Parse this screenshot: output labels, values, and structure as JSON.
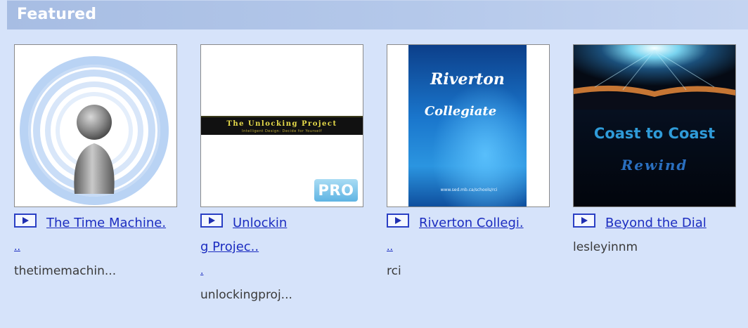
{
  "section": {
    "title": "Featured"
  },
  "items": [
    {
      "title_line1": "The Time Machine.",
      "title_line2": "..",
      "title_line3": "",
      "author": "thetimemachin...",
      "thumbnail": "podcast-person-icon"
    },
    {
      "title_line1": "Unlockin",
      "title_line2": "g Projec..",
      "title_line3": ".",
      "author": "unlockingproj...",
      "thumbnail_banner": "The Unlocking Project",
      "thumbnail_sub": "Intelligent Design: Decide for Yourself",
      "badge": "PRO"
    },
    {
      "title_line1": "Riverton Collegi.",
      "title_line2": "..",
      "title_line3": "",
      "author": "rci",
      "thumbnail_line1": "Riverton",
      "thumbnail_line2": "Collegiate",
      "thumbnail_url": "www.sed.mb.ca/schools/rci"
    },
    {
      "title_line1": "Beyond the Dial",
      "title_line2": "",
      "title_line3": "",
      "author": "lesleyinnm",
      "thumbnail_line1": "Coast to Coast",
      "thumbnail_line2": "Rewind"
    }
  ],
  "colors": {
    "background": "#d6e3fa",
    "header": "#a7bde3",
    "link": "#1b2cc0",
    "author": "#3a3a3a"
  }
}
